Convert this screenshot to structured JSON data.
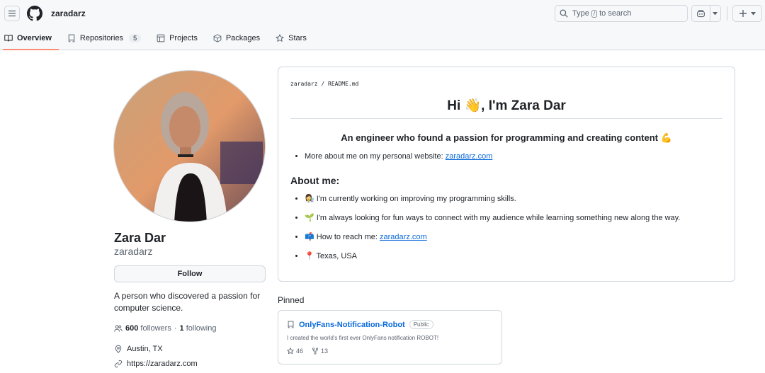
{
  "header": {
    "username": "zaradarz",
    "search_prefix": "Type",
    "search_key": "/",
    "search_suffix": "to search"
  },
  "tabs": [
    {
      "label": "Overview",
      "icon": "book-icon",
      "active": true
    },
    {
      "label": "Repositories",
      "icon": "repo-icon",
      "count": "5"
    },
    {
      "label": "Projects",
      "icon": "table-icon"
    },
    {
      "label": "Packages",
      "icon": "package-icon"
    },
    {
      "label": "Stars",
      "icon": "star-icon"
    }
  ],
  "profile": {
    "name": "Zara Dar",
    "login": "zaradarz",
    "follow_label": "Follow",
    "bio": "A person who discovered a passion for computer science.",
    "followers_count": "600",
    "followers_label": "followers",
    "following_sep": "·",
    "following_count": "1",
    "following_label": "following",
    "location": "Austin, TX",
    "website": "https://zaradarz.com"
  },
  "readme": {
    "path_user": "zaradarz",
    "path_sep": "/",
    "path_file": "README.md",
    "h1": "Hi 👋, I'm Zara Dar",
    "subtitle": "An engineer who found a passion for programming and creating content 💪",
    "intro_text": "More about me on my personal website: ",
    "intro_link": "zaradarz.com",
    "about_heading": "About me:",
    "items": {
      "working": "👩‍🔬 I'm currently working on improving my programming skills.",
      "fun": "🌱 I'm always looking for fun ways to connect with my audience while learning something new along the way.",
      "reach_text": "📫 How to reach me: ",
      "reach_link": "zaradarz.com",
      "location": "📍 Texas, USA"
    }
  },
  "pinned": {
    "title": "Pinned",
    "repo": {
      "name": "OnlyFans-Notification-Robot",
      "visibility": "Public",
      "description": "I created the world's first ever OnlyFans notification ROBOT!",
      "stars": "46",
      "forks": "13"
    }
  },
  "colors": {
    "accent_link": "#0969da",
    "tab_underline": "#fd8c73",
    "header_bg": "#f6f8fa",
    "border": "#d0d7de"
  }
}
